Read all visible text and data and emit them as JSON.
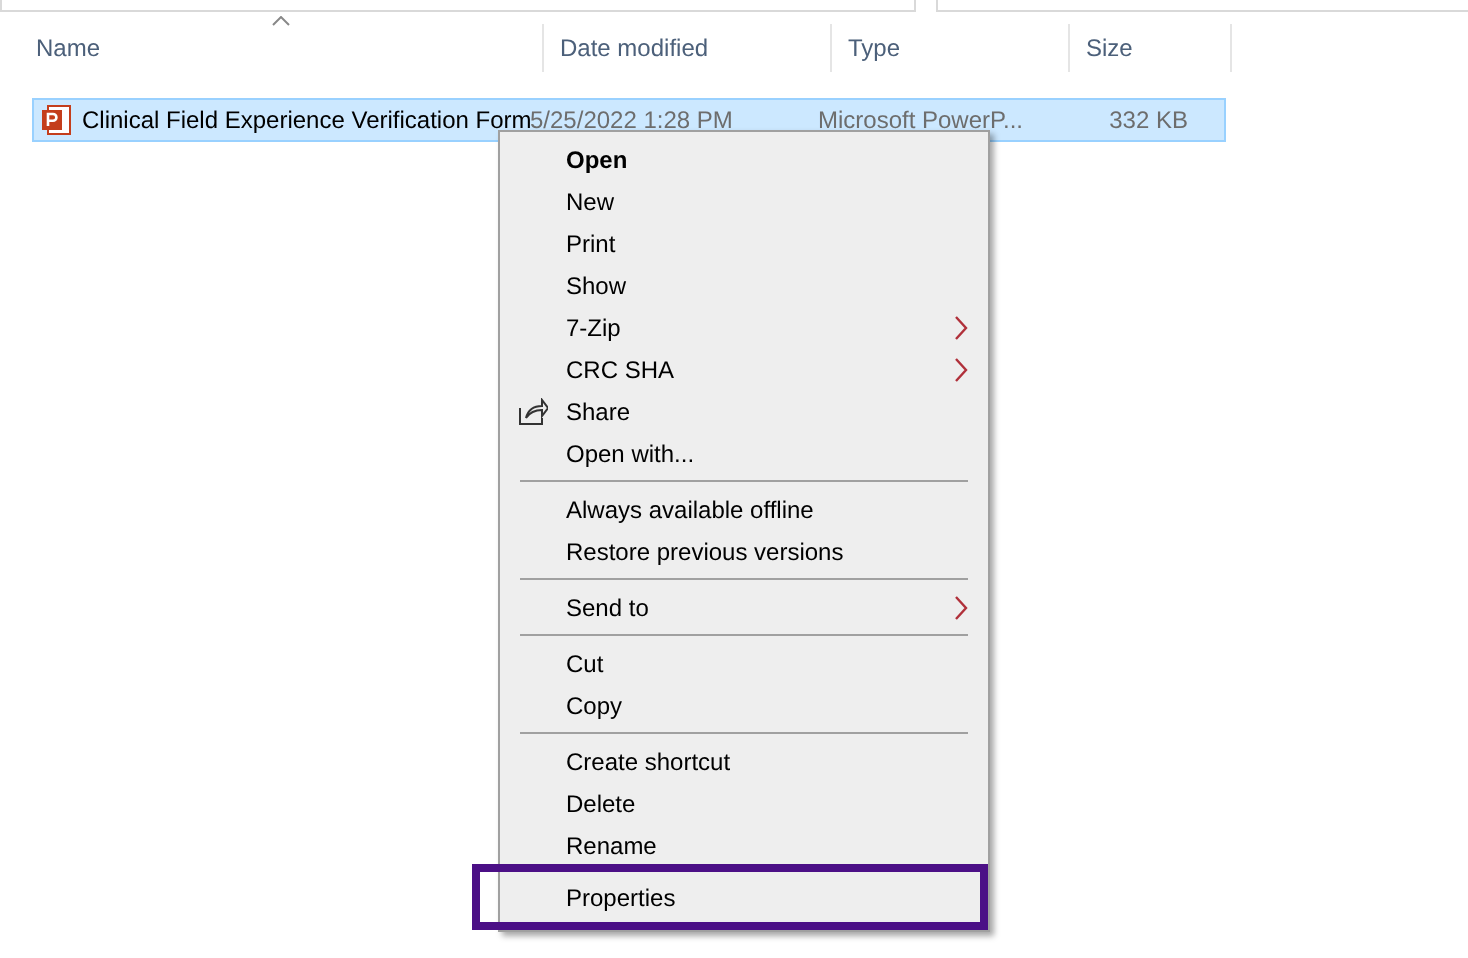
{
  "columns": [
    {
      "label": "Name",
      "sorted": true
    },
    {
      "label": "Date modified",
      "sorted": false
    },
    {
      "label": "Type",
      "sorted": false
    },
    {
      "label": "Size",
      "sorted": false
    }
  ],
  "files": [
    {
      "name": "Clinical Field Experience Verification Form",
      "date": "5/25/2022 1:28 PM",
      "type": "Microsoft PowerP...",
      "size": "332 KB",
      "selected": true
    }
  ],
  "context_menu": {
    "groups": [
      {
        "items": [
          {
            "label": "Open",
            "default": true,
            "submenu": false,
            "share_icon": false,
            "highlighted": false
          },
          {
            "label": "New",
            "default": false,
            "submenu": false,
            "share_icon": false,
            "highlighted": false
          },
          {
            "label": "Print",
            "default": false,
            "submenu": false,
            "share_icon": false,
            "highlighted": false
          },
          {
            "label": "Show",
            "default": false,
            "submenu": false,
            "share_icon": false,
            "highlighted": false
          },
          {
            "label": "7-Zip",
            "default": false,
            "submenu": true,
            "share_icon": false,
            "highlighted": false
          },
          {
            "label": "CRC SHA",
            "default": false,
            "submenu": true,
            "share_icon": false,
            "highlighted": false
          },
          {
            "label": "Share",
            "default": false,
            "submenu": false,
            "share_icon": true,
            "highlighted": false
          },
          {
            "label": "Open with...",
            "default": false,
            "submenu": false,
            "share_icon": false,
            "highlighted": false
          }
        ]
      },
      {
        "items": [
          {
            "label": "Always available offline",
            "default": false,
            "submenu": false,
            "share_icon": false,
            "highlighted": false
          },
          {
            "label": "Restore previous versions",
            "default": false,
            "submenu": false,
            "share_icon": false,
            "highlighted": false
          }
        ]
      },
      {
        "items": [
          {
            "label": "Send to",
            "default": false,
            "submenu": true,
            "share_icon": false,
            "highlighted": false
          }
        ]
      },
      {
        "items": [
          {
            "label": "Cut",
            "default": false,
            "submenu": false,
            "share_icon": false,
            "highlighted": false
          },
          {
            "label": "Copy",
            "default": false,
            "submenu": false,
            "share_icon": false,
            "highlighted": false
          }
        ]
      },
      {
        "items": [
          {
            "label": "Create shortcut",
            "default": false,
            "submenu": false,
            "share_icon": false,
            "highlighted": false
          },
          {
            "label": "Delete",
            "default": false,
            "submenu": false,
            "share_icon": false,
            "highlighted": false
          },
          {
            "label": "Rename",
            "default": false,
            "submenu": false,
            "share_icon": false,
            "highlighted": false
          },
          {
            "label": "Properties",
            "default": false,
            "submenu": false,
            "share_icon": false,
            "highlighted": true
          }
        ]
      }
    ]
  }
}
